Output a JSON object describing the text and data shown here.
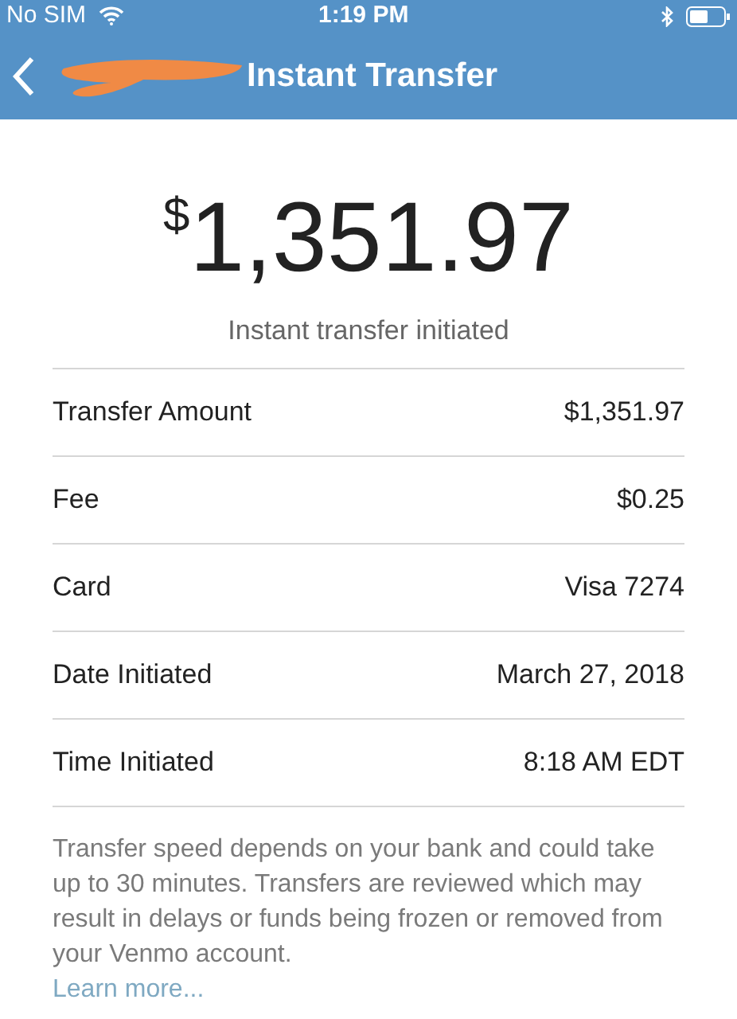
{
  "status_bar": {
    "carrier": "No SIM",
    "time": "1:19 PM"
  },
  "nav": {
    "title": "Instant Transfer"
  },
  "amount": {
    "currency": "$",
    "value": "1,351.97",
    "caption": "Instant transfer initiated"
  },
  "details": [
    {
      "label": "Transfer Amount",
      "value": "$1,351.97"
    },
    {
      "label": "Fee",
      "value": "$0.25"
    },
    {
      "label": "Card",
      "value": "Visa 7274"
    },
    {
      "label": "Date Initiated",
      "value": "March 27, 2018"
    },
    {
      "label": "Time Initiated",
      "value": "8:18 AM EDT"
    }
  ],
  "notice": {
    "text": "Transfer speed depends on your bank and could take up to 30 minutes. Transfers are reviewed which may result in delays or funds being frozen or removed from your Venmo account.",
    "link": "Learn more..."
  }
}
